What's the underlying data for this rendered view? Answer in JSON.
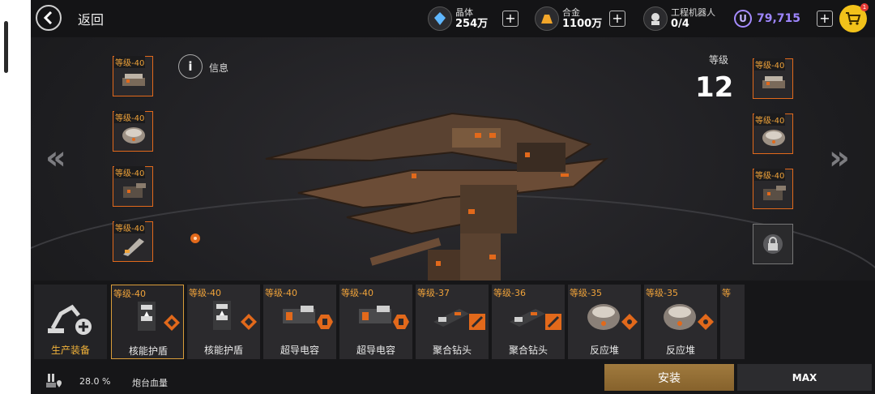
{
  "header": {
    "back_label": "返回",
    "crystal": {
      "label": "晶体",
      "value": "254万",
      "icon": "crystal-icon"
    },
    "alloy": {
      "label": "合金",
      "value": "1100万",
      "icon": "alloy-icon"
    },
    "robots": {
      "label": "工程机器人",
      "value": "0/4",
      "icon": "robot-icon"
    },
    "currency": {
      "symbol": "U",
      "value": "79,715"
    },
    "plus": "+",
    "cart_badge": "1"
  },
  "info_label": "信息",
  "level": {
    "label": "等级",
    "value": "12"
  },
  "left_slots": [
    {
      "level": "等级-40",
      "icon": "turret-icon"
    },
    {
      "level": "等级-40",
      "icon": "reactor-icon"
    },
    {
      "level": "等级-40",
      "icon": "turret-icon"
    },
    {
      "level": "等级-40",
      "icon": "drill-icon"
    }
  ],
  "right_slots": [
    {
      "level": "等级-40",
      "icon": "turret-icon"
    },
    {
      "level": "等级-40",
      "icon": "reactor-icon"
    },
    {
      "level": "等级-40",
      "icon": "turret-icon"
    }
  ],
  "locked_slot_icon": "lock-icon",
  "production": {
    "label": "生产装备",
    "icon": "robot-arm-icon"
  },
  "inventory": [
    {
      "level": "等级-40",
      "name": "核能护盾",
      "selected": true
    },
    {
      "level": "等级-40",
      "name": "核能护盾",
      "selected": false
    },
    {
      "level": "等级-40",
      "name": "超导电容",
      "selected": false
    },
    {
      "level": "等级-40",
      "name": "超导电容",
      "selected": false
    },
    {
      "level": "等级-37",
      "name": "聚合钻头",
      "selected": false
    },
    {
      "level": "等级-36",
      "name": "聚合钻头",
      "selected": false
    },
    {
      "level": "等级-35",
      "name": "反应堆",
      "selected": false
    },
    {
      "level": "等级-35",
      "name": "反应堆",
      "selected": false
    }
  ],
  "inventory_overflow_label": "等",
  "hp": {
    "percent": "28.0 %",
    "label": "炮台血量"
  },
  "buttons": {
    "install": "安装",
    "max": "MAX"
  },
  "colors": {
    "accent_orange": "#e2691b",
    "level_text": "#f0a33a",
    "currency_purple": "#9e86ff"
  }
}
